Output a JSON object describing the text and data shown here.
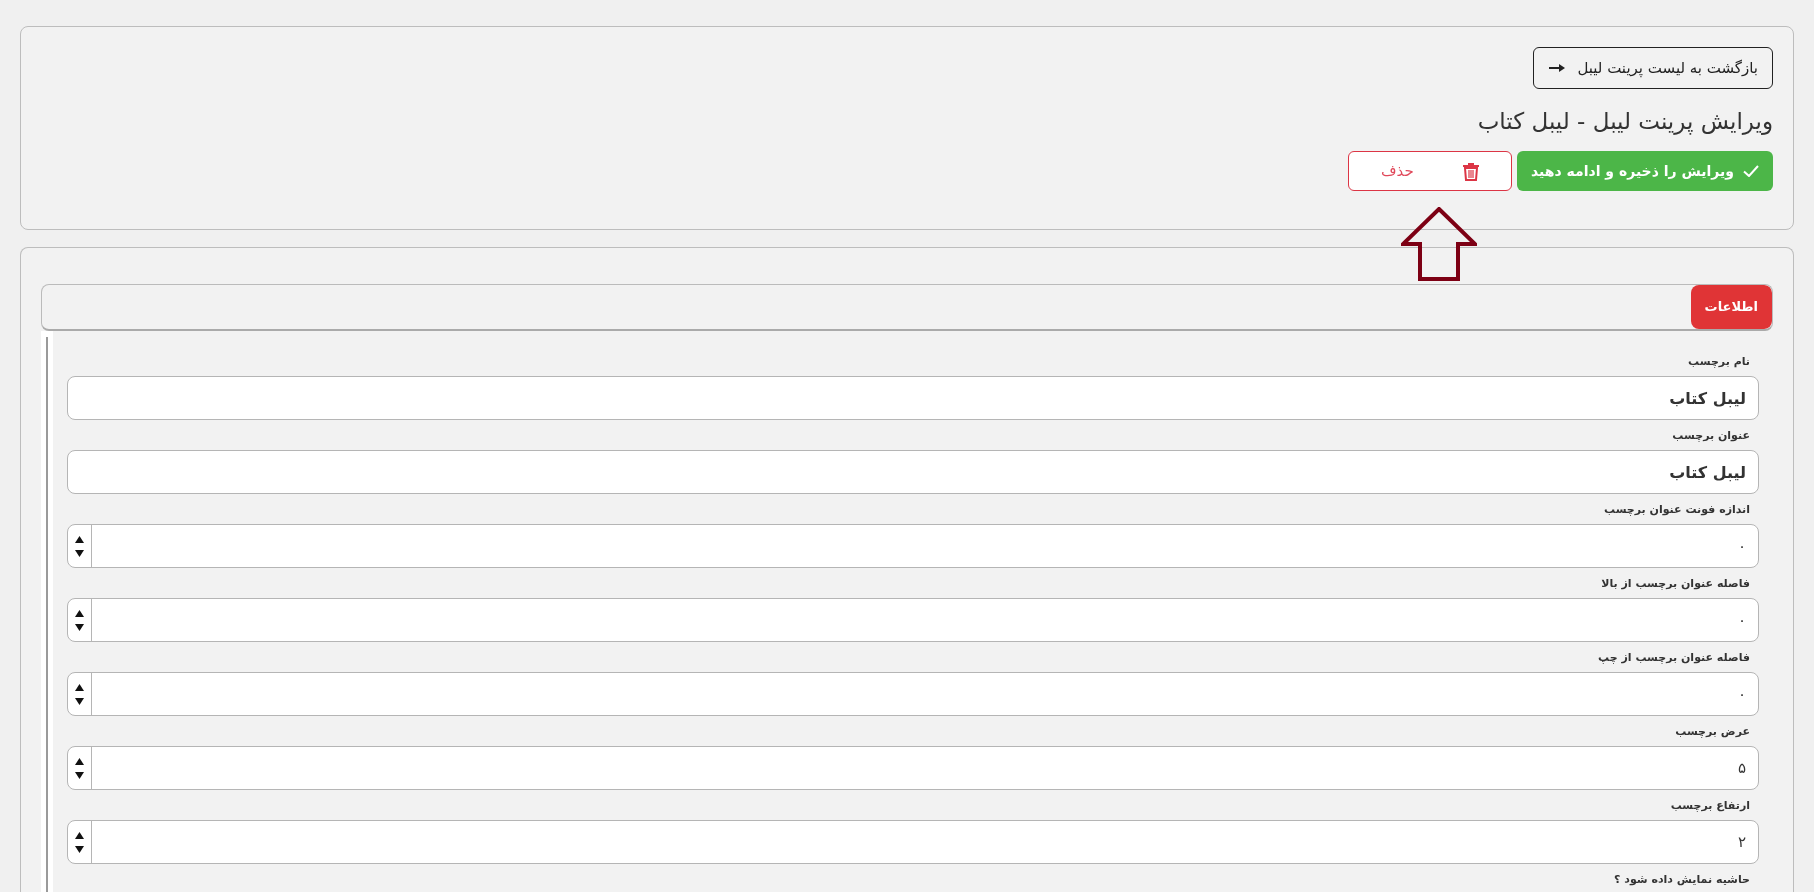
{
  "header": {
    "back_button": {
      "label": "بازگشت به لیست پرینت لیبل"
    },
    "title": "ویرایش پرینت لیبل - لیبل کتاب",
    "actions": [
      {
        "kind": "save",
        "label": "ویرایش را ذخیره و ادامه دهید"
      },
      {
        "kind": "delete",
        "label": "حذف"
      }
    ]
  },
  "annotations": [
    {
      "kind": "arrow"
    }
  ],
  "tabs": [
    {
      "label": "اطلاعات",
      "selected": true
    }
  ],
  "form": {
    "fields": [
      {
        "kind": "text",
        "label": "نام برچسب",
        "value": "لیبل کتاب"
      },
      {
        "kind": "text",
        "label": "عنوان برچسب",
        "value": "لیبل کتاب"
      },
      {
        "kind": "number",
        "label": "اندازه فونت عنوان برچسب",
        "value": "۰"
      },
      {
        "kind": "number",
        "label": "فاصله عنوان برچسب از بالا",
        "value": "۰"
      },
      {
        "kind": "number",
        "label": "فاصله عنوان برچسب از چپ",
        "value": "۰"
      },
      {
        "kind": "number",
        "label": "عرض برچسب",
        "value": "۵"
      },
      {
        "kind": "number",
        "label": "ارتفاع برچسب",
        "value": "۲"
      },
      {
        "kind": "label",
        "label": "حاشیه نمایش داده شود ؟"
      }
    ]
  }
}
